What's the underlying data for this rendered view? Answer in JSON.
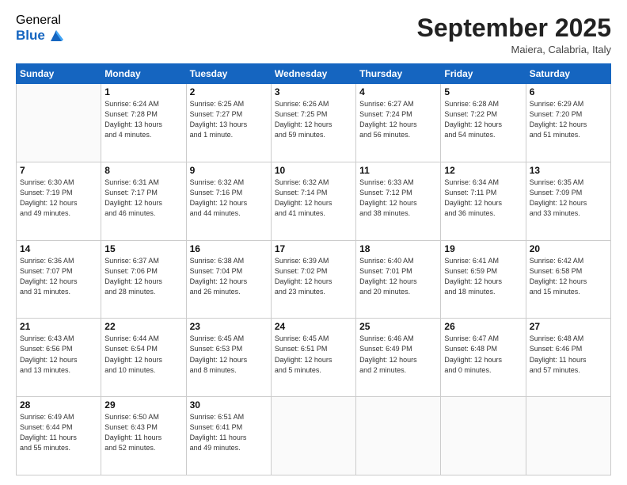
{
  "logo": {
    "general": "General",
    "blue": "Blue"
  },
  "header": {
    "month": "September 2025",
    "location": "Maiera, Calabria, Italy"
  },
  "weekdays": [
    "Sunday",
    "Monday",
    "Tuesday",
    "Wednesday",
    "Thursday",
    "Friday",
    "Saturday"
  ],
  "weeks": [
    [
      {
        "day": "",
        "info": ""
      },
      {
        "day": "1",
        "info": "Sunrise: 6:24 AM\nSunset: 7:28 PM\nDaylight: 13 hours\nand 4 minutes."
      },
      {
        "day": "2",
        "info": "Sunrise: 6:25 AM\nSunset: 7:27 PM\nDaylight: 13 hours\nand 1 minute."
      },
      {
        "day": "3",
        "info": "Sunrise: 6:26 AM\nSunset: 7:25 PM\nDaylight: 12 hours\nand 59 minutes."
      },
      {
        "day": "4",
        "info": "Sunrise: 6:27 AM\nSunset: 7:24 PM\nDaylight: 12 hours\nand 56 minutes."
      },
      {
        "day": "5",
        "info": "Sunrise: 6:28 AM\nSunset: 7:22 PM\nDaylight: 12 hours\nand 54 minutes."
      },
      {
        "day": "6",
        "info": "Sunrise: 6:29 AM\nSunset: 7:20 PM\nDaylight: 12 hours\nand 51 minutes."
      }
    ],
    [
      {
        "day": "7",
        "info": "Sunrise: 6:30 AM\nSunset: 7:19 PM\nDaylight: 12 hours\nand 49 minutes."
      },
      {
        "day": "8",
        "info": "Sunrise: 6:31 AM\nSunset: 7:17 PM\nDaylight: 12 hours\nand 46 minutes."
      },
      {
        "day": "9",
        "info": "Sunrise: 6:32 AM\nSunset: 7:16 PM\nDaylight: 12 hours\nand 44 minutes."
      },
      {
        "day": "10",
        "info": "Sunrise: 6:32 AM\nSunset: 7:14 PM\nDaylight: 12 hours\nand 41 minutes."
      },
      {
        "day": "11",
        "info": "Sunrise: 6:33 AM\nSunset: 7:12 PM\nDaylight: 12 hours\nand 38 minutes."
      },
      {
        "day": "12",
        "info": "Sunrise: 6:34 AM\nSunset: 7:11 PM\nDaylight: 12 hours\nand 36 minutes."
      },
      {
        "day": "13",
        "info": "Sunrise: 6:35 AM\nSunset: 7:09 PM\nDaylight: 12 hours\nand 33 minutes."
      }
    ],
    [
      {
        "day": "14",
        "info": "Sunrise: 6:36 AM\nSunset: 7:07 PM\nDaylight: 12 hours\nand 31 minutes."
      },
      {
        "day": "15",
        "info": "Sunrise: 6:37 AM\nSunset: 7:06 PM\nDaylight: 12 hours\nand 28 minutes."
      },
      {
        "day": "16",
        "info": "Sunrise: 6:38 AM\nSunset: 7:04 PM\nDaylight: 12 hours\nand 26 minutes."
      },
      {
        "day": "17",
        "info": "Sunrise: 6:39 AM\nSunset: 7:02 PM\nDaylight: 12 hours\nand 23 minutes."
      },
      {
        "day": "18",
        "info": "Sunrise: 6:40 AM\nSunset: 7:01 PM\nDaylight: 12 hours\nand 20 minutes."
      },
      {
        "day": "19",
        "info": "Sunrise: 6:41 AM\nSunset: 6:59 PM\nDaylight: 12 hours\nand 18 minutes."
      },
      {
        "day": "20",
        "info": "Sunrise: 6:42 AM\nSunset: 6:58 PM\nDaylight: 12 hours\nand 15 minutes."
      }
    ],
    [
      {
        "day": "21",
        "info": "Sunrise: 6:43 AM\nSunset: 6:56 PM\nDaylight: 12 hours\nand 13 minutes."
      },
      {
        "day": "22",
        "info": "Sunrise: 6:44 AM\nSunset: 6:54 PM\nDaylight: 12 hours\nand 10 minutes."
      },
      {
        "day": "23",
        "info": "Sunrise: 6:45 AM\nSunset: 6:53 PM\nDaylight: 12 hours\nand 8 minutes."
      },
      {
        "day": "24",
        "info": "Sunrise: 6:45 AM\nSunset: 6:51 PM\nDaylight: 12 hours\nand 5 minutes."
      },
      {
        "day": "25",
        "info": "Sunrise: 6:46 AM\nSunset: 6:49 PM\nDaylight: 12 hours\nand 2 minutes."
      },
      {
        "day": "26",
        "info": "Sunrise: 6:47 AM\nSunset: 6:48 PM\nDaylight: 12 hours\nand 0 minutes."
      },
      {
        "day": "27",
        "info": "Sunrise: 6:48 AM\nSunset: 6:46 PM\nDaylight: 11 hours\nand 57 minutes."
      }
    ],
    [
      {
        "day": "28",
        "info": "Sunrise: 6:49 AM\nSunset: 6:44 PM\nDaylight: 11 hours\nand 55 minutes."
      },
      {
        "day": "29",
        "info": "Sunrise: 6:50 AM\nSunset: 6:43 PM\nDaylight: 11 hours\nand 52 minutes."
      },
      {
        "day": "30",
        "info": "Sunrise: 6:51 AM\nSunset: 6:41 PM\nDaylight: 11 hours\nand 49 minutes."
      },
      {
        "day": "",
        "info": ""
      },
      {
        "day": "",
        "info": ""
      },
      {
        "day": "",
        "info": ""
      },
      {
        "day": "",
        "info": ""
      }
    ]
  ]
}
